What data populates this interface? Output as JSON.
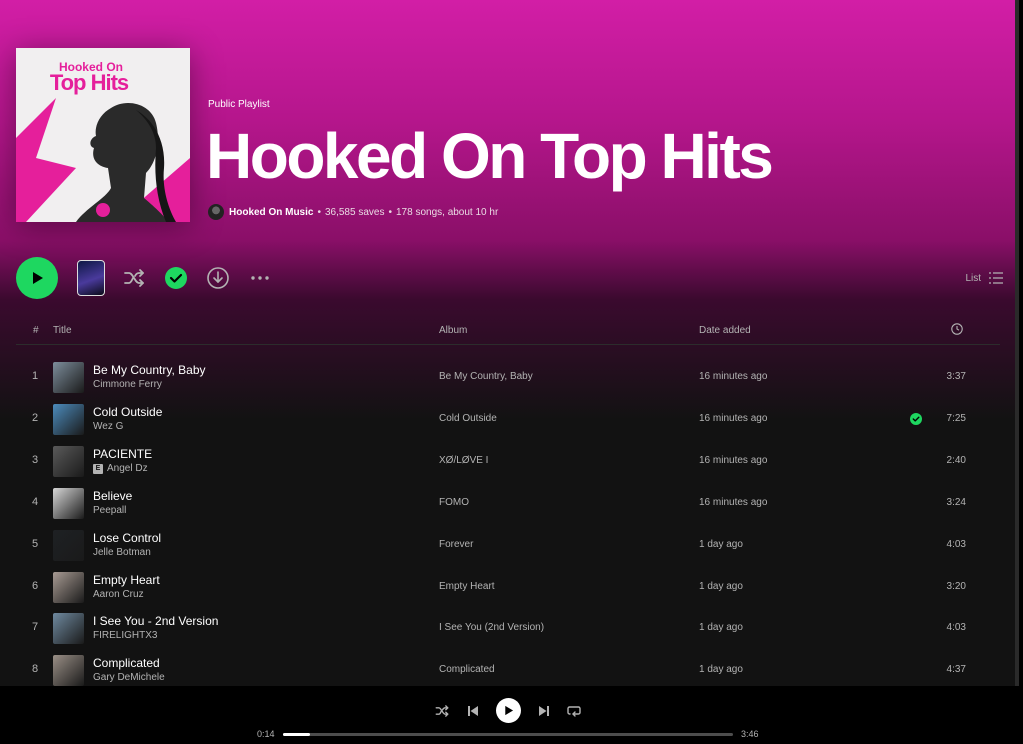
{
  "playlist": {
    "type_label": "Public Playlist",
    "title": "Hooked On Top Hits",
    "cover_line1": "Hooked On",
    "cover_line2": "Top Hits",
    "owner": "Hooked On Music",
    "saves": "36,585 saves",
    "summary": "178 songs, about 10 hr",
    "separator": "•"
  },
  "actions": {
    "view_label": "List",
    "icons": [
      "play-icon",
      "shuffle-icon",
      "check-circle-icon",
      "download-icon",
      "more-icon",
      "list-icon"
    ]
  },
  "table": {
    "headers": {
      "num": "#",
      "title": "Title",
      "album": "Album",
      "date": "Date added",
      "duration_icon": "clock-icon"
    },
    "rows": [
      {
        "num": "1",
        "title": "Be My Country, Baby",
        "artist": "Cimmone Ferry",
        "explicit": false,
        "album": "Be My Country, Baby",
        "date": "16 minutes ago",
        "duration": "3:37",
        "saved": false,
        "thumb": "#7d8e9c"
      },
      {
        "num": "2",
        "title": "Cold Outside",
        "artist": "Wez G",
        "explicit": false,
        "album": "Cold Outside",
        "date": "16 minutes ago",
        "duration": "7:25",
        "saved": true,
        "thumb": "#4c8cbd"
      },
      {
        "num": "3",
        "title": "PACIENTE",
        "artist": "Angel Dz",
        "explicit": true,
        "explicit_label": "E",
        "album": "XØ/LØVE I",
        "date": "16 minutes ago",
        "duration": "2:40",
        "saved": false,
        "thumb": "#5a5a5a"
      },
      {
        "num": "4",
        "title": "Believe",
        "artist": "Peepall",
        "explicit": false,
        "album": "FOMO",
        "date": "16 minutes ago",
        "duration": "3:24",
        "saved": false,
        "thumb": "#d7d7d7"
      },
      {
        "num": "5",
        "title": "Lose Control",
        "artist": "Jelle Botman",
        "explicit": false,
        "album": "Forever",
        "date": "1 day ago",
        "duration": "4:03",
        "saved": false,
        "thumb": "#1e2124"
      },
      {
        "num": "6",
        "title": "Empty Heart",
        "artist": "Aaron Cruz",
        "explicit": false,
        "album": "Empty Heart",
        "date": "1 day ago",
        "duration": "3:20",
        "saved": false,
        "thumb": "#a89b93"
      },
      {
        "num": "7",
        "title": "I See You - 2nd Version",
        "artist": "FIRELIGHTX3",
        "explicit": false,
        "album": "I See You (2nd Version)",
        "date": "1 day ago",
        "duration": "4:03",
        "saved": false,
        "thumb": "#6f8aa0"
      },
      {
        "num": "8",
        "title": "Complicated",
        "artist": "Gary DeMichele",
        "explicit": false,
        "album": "Complicated",
        "date": "1 day ago",
        "duration": "4:37",
        "saved": false,
        "thumb": "#9a8f86"
      }
    ]
  },
  "player": {
    "elapsed": "0:14",
    "total": "3:46",
    "progress": 0.06,
    "icons": [
      "shuffle-icon",
      "previous-icon",
      "play-icon",
      "next-icon",
      "repeat-icon"
    ]
  },
  "colors": {
    "accent": "#1ed760",
    "header": "#d21ea6",
    "background": "#121212"
  }
}
